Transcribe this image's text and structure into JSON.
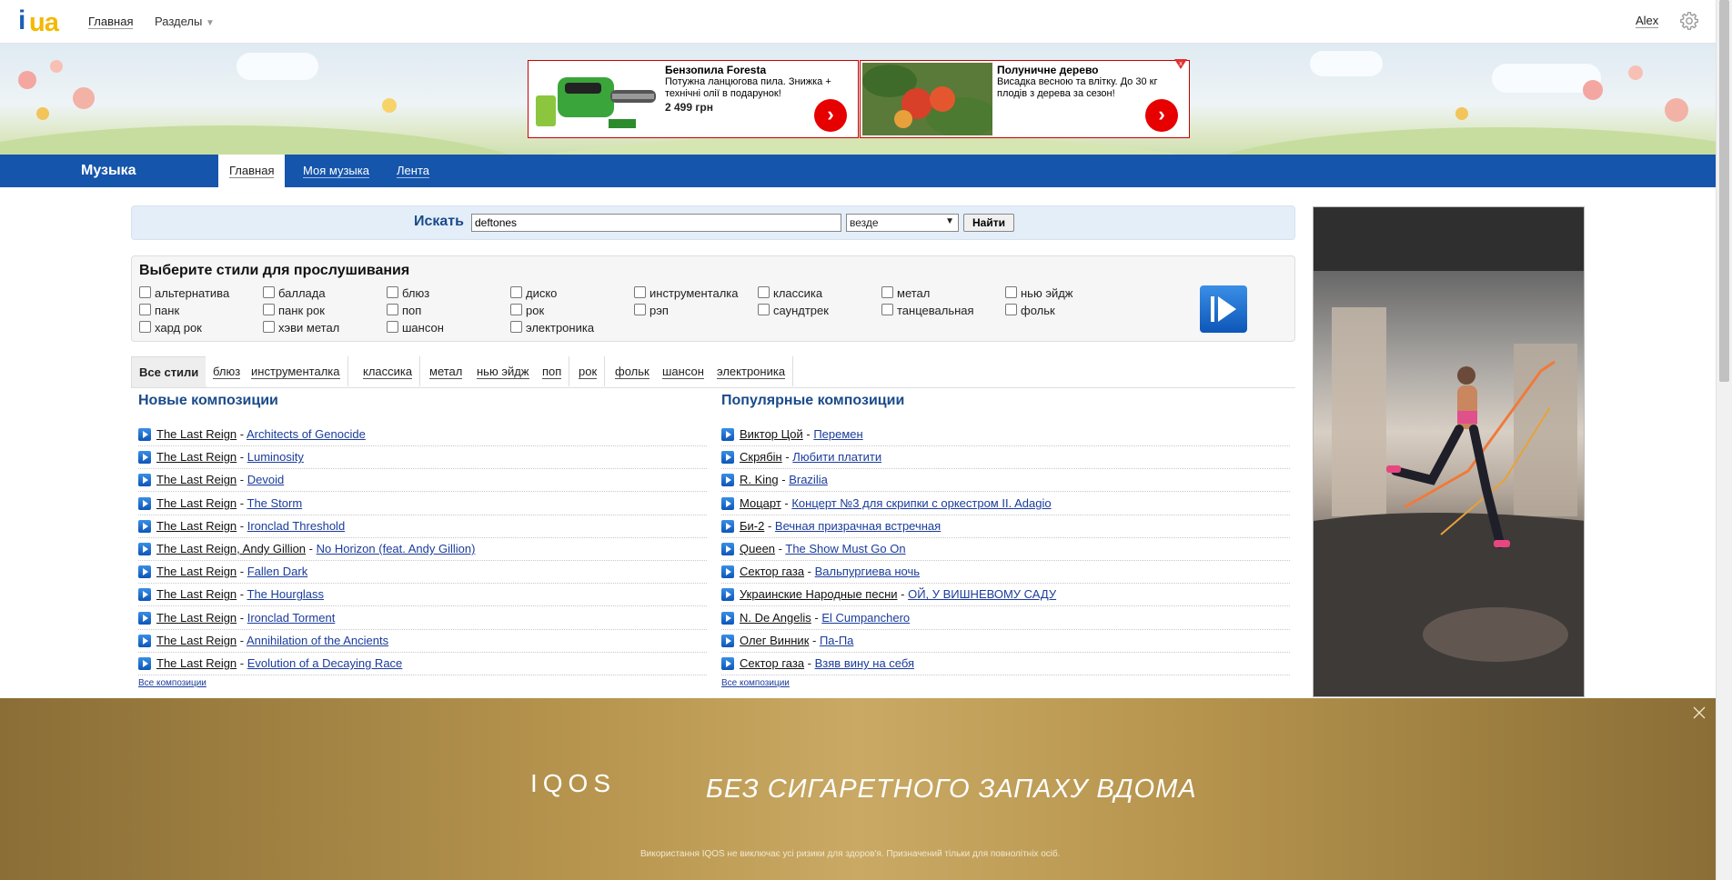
{
  "topbar": {
    "home": "Главная",
    "sections": "Разделы",
    "user": "Alex"
  },
  "ads": [
    {
      "title": "Бензопила Foresta",
      "desc": "Потужна ланцюгова пила. Знижка + технічні олії в подарунок!",
      "price": "2 499 грн"
    },
    {
      "title": "Полуничне дерево",
      "desc": "Висадка весною та влітку. До 30 кг плодів з дерева за сезон!",
      "price": ""
    }
  ],
  "nav": {
    "section": "Музыка",
    "tabs": [
      "Главная",
      "Моя музыка",
      "Лента"
    ]
  },
  "search": {
    "label": "Искать",
    "value": "deftones",
    "scope": "везде",
    "button": "Найти"
  },
  "styles": {
    "title": "Выберите стили для прослушивания",
    "items": [
      "альтернатива",
      "баллада",
      "блюз",
      "диско",
      "инструменталка",
      "классика",
      "метал",
      "нью эйдж",
      "панк",
      "панк рок",
      "поп",
      "рок",
      "рэп",
      "саундтрек",
      "танцевальная",
      "фольк",
      "хард рок",
      "хэви метал",
      "шансон",
      "электроника"
    ]
  },
  "genre_tabs": [
    "Все стили",
    "блюз",
    "инструменталка",
    "классика",
    "метал",
    "нью эйдж",
    "поп",
    "рок",
    "фольк",
    "шансон",
    "электроника"
  ],
  "new": {
    "title": "Новые композиции",
    "rows": [
      {
        "artist": "The Last Reign",
        "song": "Architects of Genocide"
      },
      {
        "artist": "The Last Reign",
        "song": "Luminosity"
      },
      {
        "artist": "The Last Reign",
        "song": "Devoid"
      },
      {
        "artist": "The Last Reign",
        "song": "The Storm"
      },
      {
        "artist": "The Last Reign",
        "song": "Ironclad Threshold"
      },
      {
        "artist": "The Last Reign, Andy Gillion",
        "song": "No Horizon (feat. Andy Gillion)"
      },
      {
        "artist": "The Last Reign",
        "song": "Fallen Dark"
      },
      {
        "artist": "The Last Reign",
        "song": "The Hourglass"
      },
      {
        "artist": "The Last Reign",
        "song": "Ironclad Torment"
      },
      {
        "artist": "The Last Reign",
        "song": "Annihilation of the Ancients"
      },
      {
        "artist": "The Last Reign",
        "song": "Evolution of a Decaying Race"
      }
    ],
    "all": "Все композиции"
  },
  "popular": {
    "title": "Популярные композиции",
    "rows": [
      {
        "artist": "Виктор Цой",
        "song": "Перемен"
      },
      {
        "artist": "Скрябін",
        "song": "Любити платити"
      },
      {
        "artist": "R. King",
        "song": "Brazilia"
      },
      {
        "artist": "Моцарт",
        "song": "Концерт №3 для скрипки с оркестром II. Adagio"
      },
      {
        "artist": "Би-2",
        "song": "Вечная призрачная встречная"
      },
      {
        "artist": "Queen",
        "song": "The Show Must Go On"
      },
      {
        "artist": "Сектор газа",
        "song": "Вальпургиева ночь"
      },
      {
        "artist": "Украинские Народные песни",
        "song": "ОЙ, У ВИШНЕВОМУ САДУ"
      },
      {
        "artist": "N. De Angelis",
        "song": "El Cumpanchero"
      },
      {
        "artist": "Олег Винник",
        "song": "Па-Па"
      },
      {
        "artist": "Сектор газа",
        "song": "Взяв вину на себя"
      }
    ],
    "all": "Все композиции"
  },
  "bottom_ad": {
    "logo": "IQOS",
    "slogan": "БЕЗ СИГАРЕТНОГО ЗАПАХУ ВДОМА",
    "note": "Використання IQOS не виключає усі ризики для здоров'я. Призначений тільки для повнолітніх осіб."
  },
  "colors": {
    "brand_blue": "#1555ab",
    "link": "#1a3c9c",
    "ad_red": "#e60000",
    "iqos_gold": "#b8964f"
  }
}
